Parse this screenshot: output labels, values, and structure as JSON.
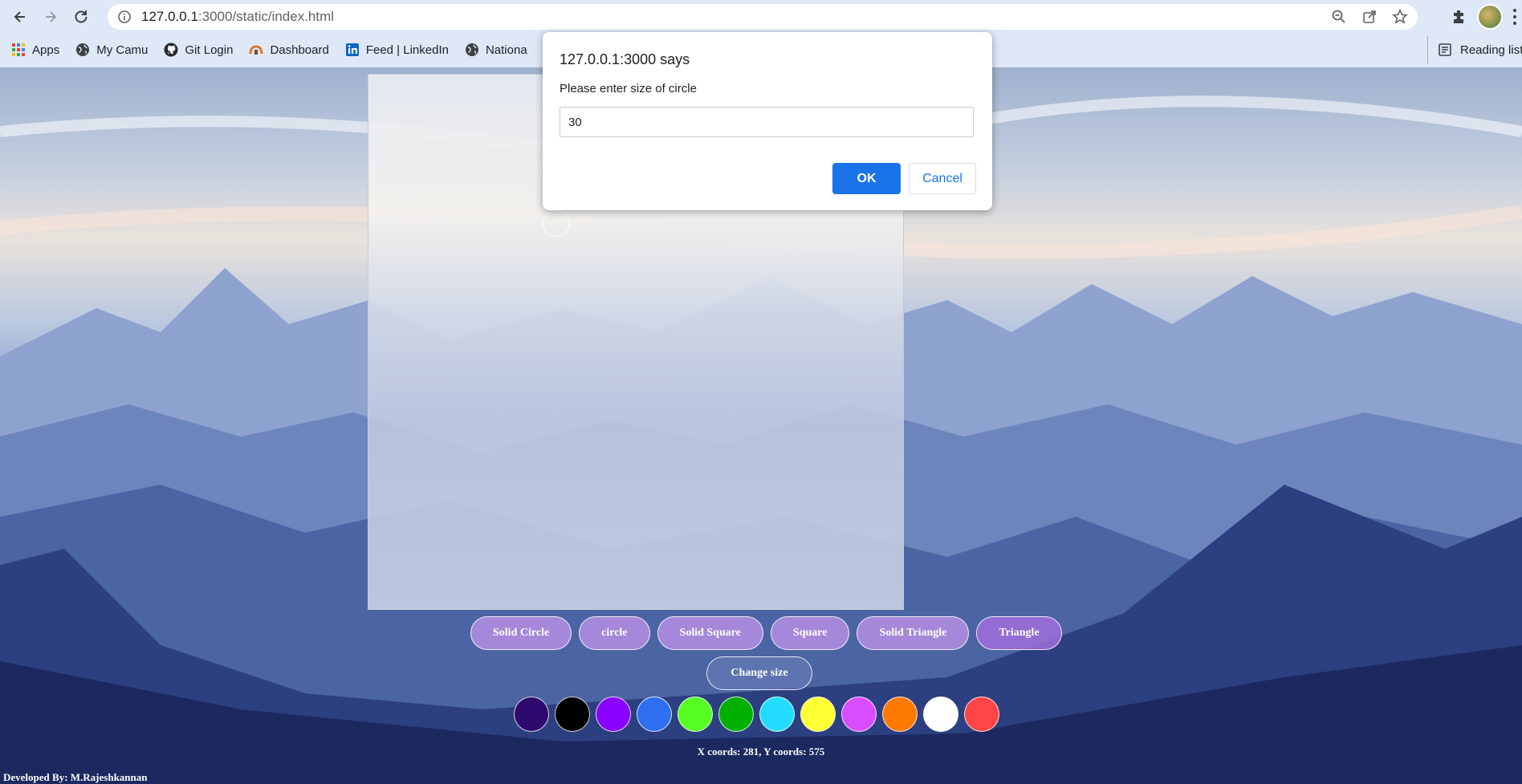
{
  "browser": {
    "url_host": "127.0.0.1",
    "url_rest": ":3000/static/index.html",
    "bookmarks": [
      {
        "label": "Apps",
        "icon": "apps-grid-icon"
      },
      {
        "label": "My Camu",
        "icon": "globe-icon"
      },
      {
        "label": "Git Login",
        "icon": "github-icon"
      },
      {
        "label": "Dashboard",
        "icon": "dashboard-icon"
      },
      {
        "label": "Feed | LinkedIn",
        "icon": "linkedin-icon"
      },
      {
        "label": "Nationa",
        "icon": "globe-icon"
      }
    ],
    "reading_list": "Reading list"
  },
  "dialog": {
    "title": "127.0.0.1:3000 says",
    "message": "Please enter size of circle",
    "input_value": "30",
    "ok_label": "OK",
    "cancel_label": "Cancel"
  },
  "toolbar": {
    "shapes": [
      "Solid Circle",
      "circle",
      "Solid Square",
      "Square",
      "Solid Triangle",
      "Triangle"
    ],
    "change_size": "Change size"
  },
  "colors": [
    "#2e0a6e",
    "#000000",
    "#8a00ff",
    "#2f6ff2",
    "#55ff22",
    "#00b000",
    "#22ddff",
    "#ffff33",
    "#d84dff",
    "#ff7a00",
    "#ffffff",
    "#ff4545"
  ],
  "status": {
    "coords": "X coords: 281, Y coords: 575",
    "credit": "Developed By: M.Rajeshkannan"
  }
}
